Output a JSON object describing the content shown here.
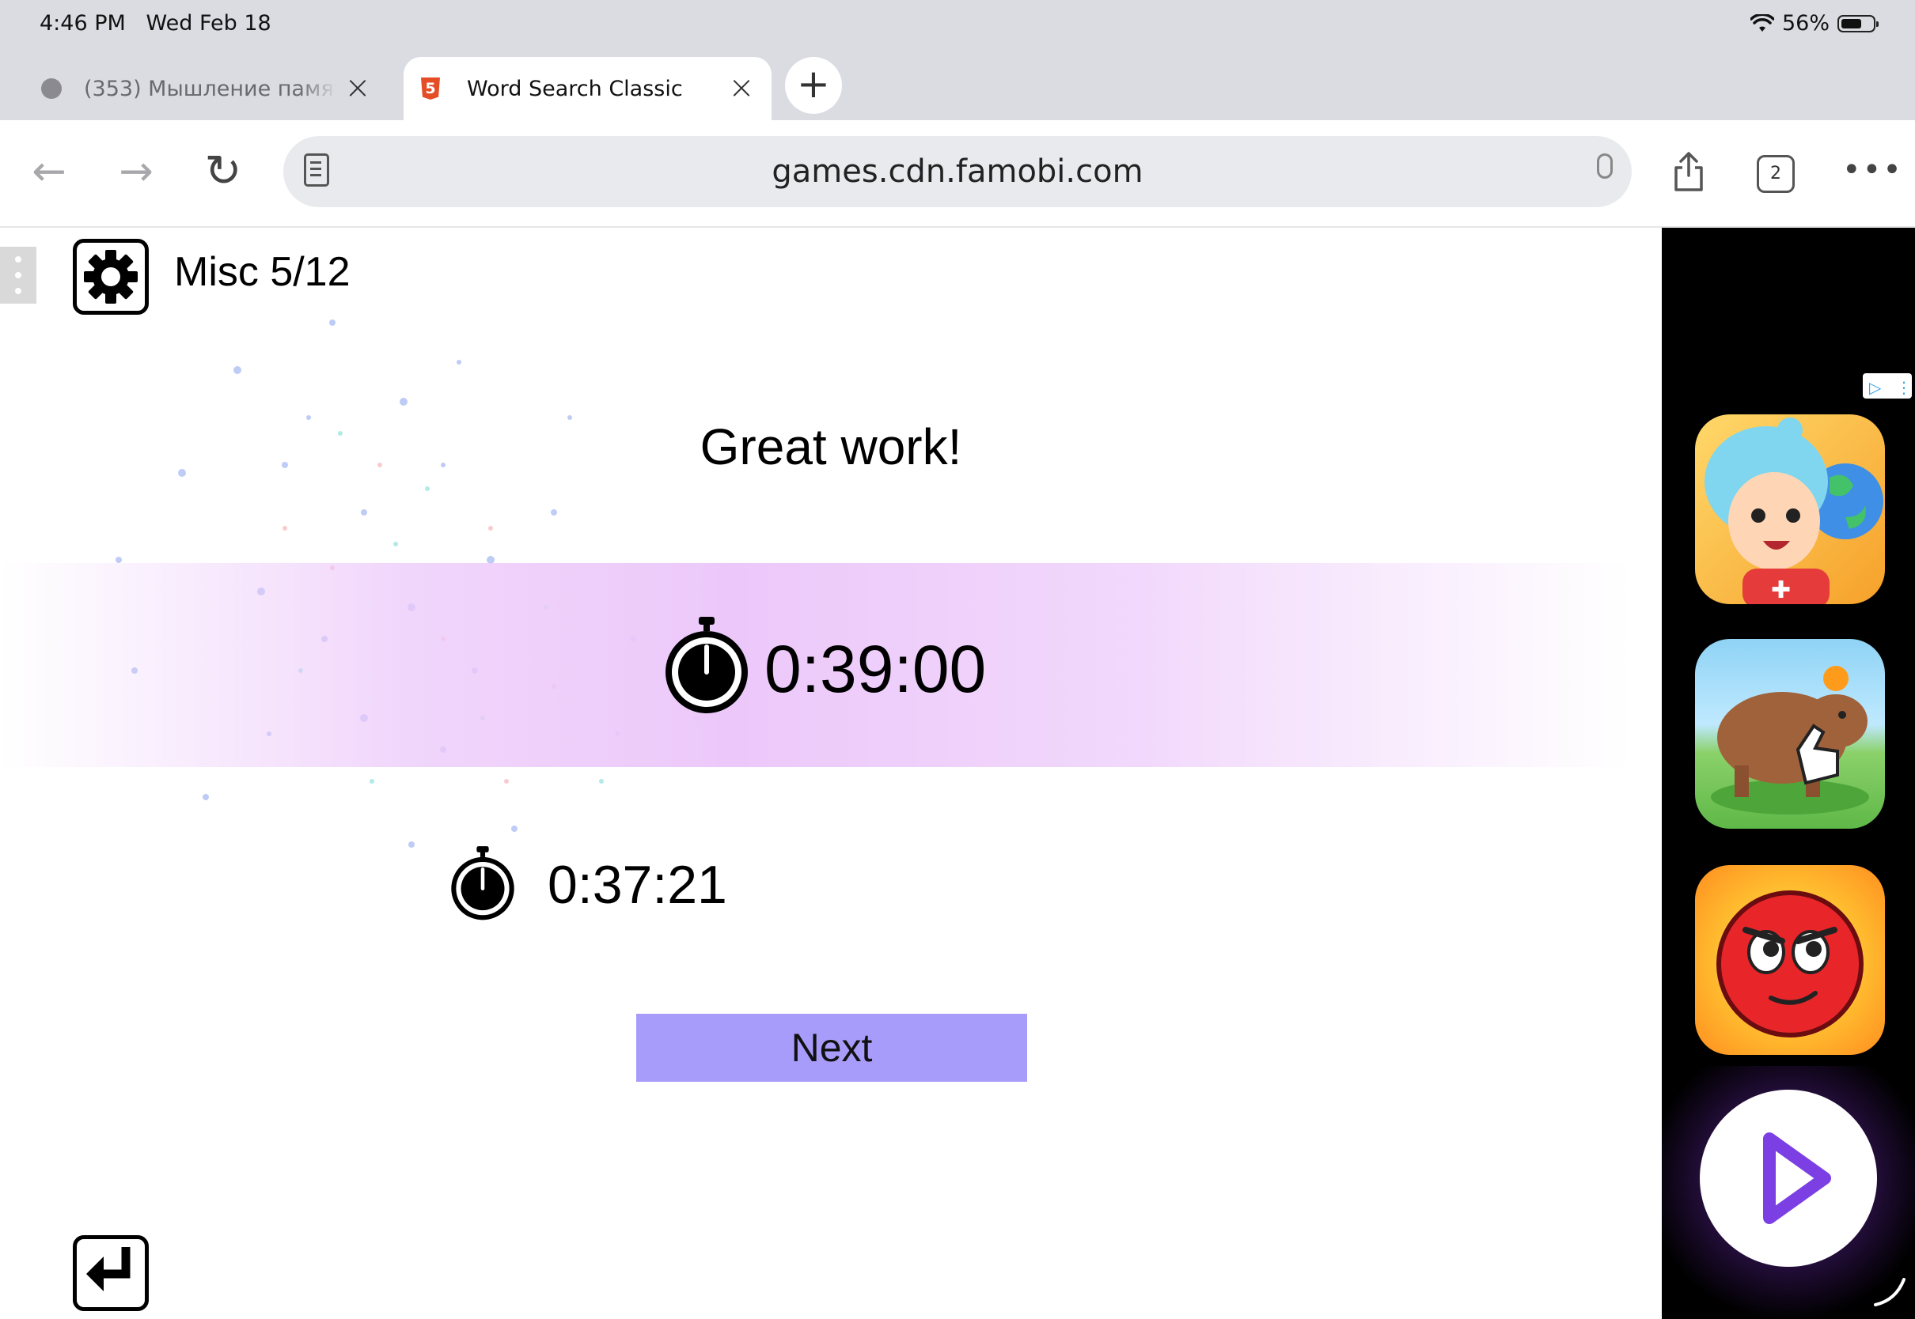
{
  "status_bar": {
    "time": "4:46 PM",
    "date": "Wed Feb 18",
    "battery": "56%",
    "battery_level": 0.56
  },
  "tabs": [
    {
      "title": "(353) Мышление памят",
      "active": false,
      "icon": "globe-icon"
    },
    {
      "title": "Word Search Classic",
      "active": true,
      "icon": "html5-icon"
    }
  ],
  "new_tab_label": "+",
  "toolbar": {
    "url": "games.cdn.famobi.com",
    "open_tabs": "2"
  },
  "game": {
    "level": "Misc 5/12",
    "headline": "Great work!",
    "current_time": "0:39:00",
    "best_time": "0:37:21",
    "next_label": "Next"
  },
  "colors": {
    "next_button": "#a89cfa",
    "banner": "#ecc8fa",
    "address_bar": "#e9eaee"
  }
}
